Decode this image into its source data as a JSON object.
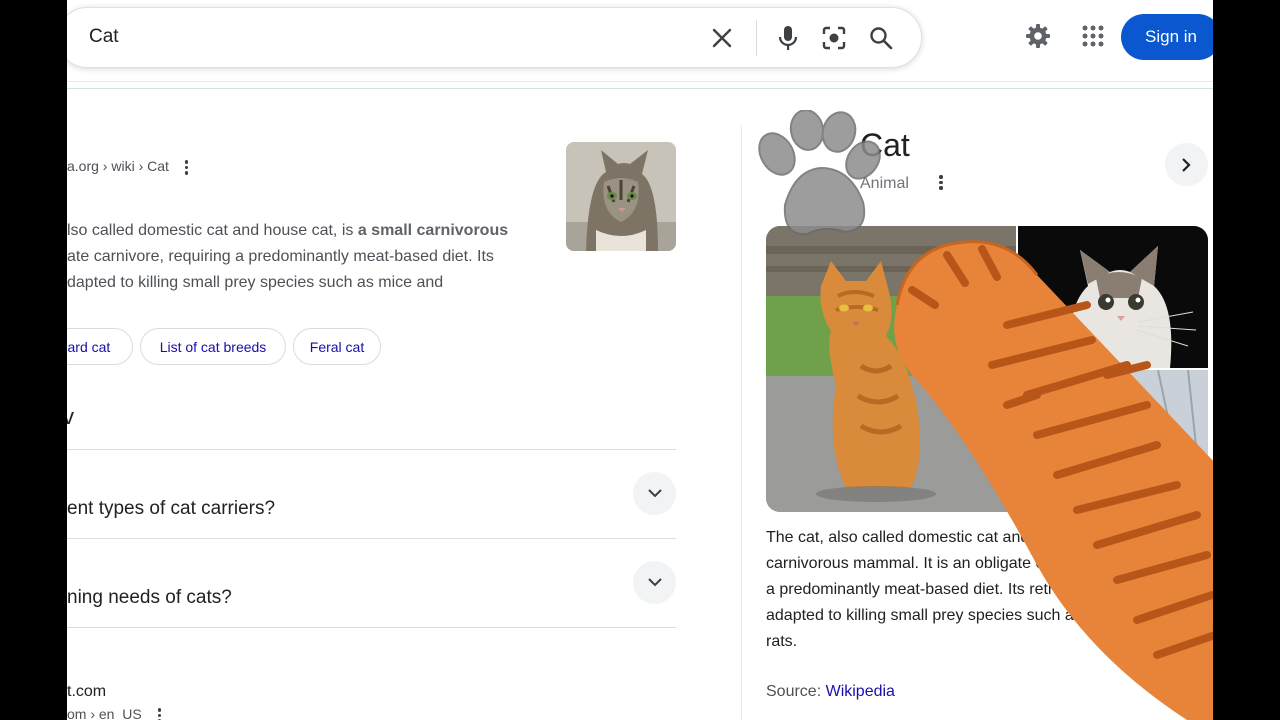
{
  "search": {
    "query": "Cat"
  },
  "header": {
    "sign_in_label": "Sign in"
  },
  "results": {
    "first": {
      "breadcrumb_visible": "a.org › wiki › Cat",
      "snippet_line_1_plain": "lso called domestic cat and house cat, is ",
      "snippet_line_1_bold": "a small carnivorous",
      "snippet_line_2": "ate carnivore, requiring a predominantly meat-based diet. Its",
      "snippet_line_3": "dapted to killing small prey species such as mice and"
    },
    "chips": [
      {
        "label": "bard cat"
      },
      {
        "label": "List of cat breeds"
      },
      {
        "label": "Feral cat"
      }
    ],
    "paa_title": "v",
    "questions": [
      {
        "label": "ent types of cat carriers?"
      },
      {
        "label": "ning needs of cats?"
      }
    ],
    "second": {
      "site": "t.com",
      "breadcrumb": "om › en_US"
    }
  },
  "knowledge_panel": {
    "title": "Cat",
    "subtitle": "Animal",
    "description_lines": [
      "The cat, also called domestic cat and h",
      "carnivorous mammal. It is an obligate carni",
      "a predominantly meat-based diet. Its retracta",
      "adapted to killing small prey species such as mic",
      "rats."
    ],
    "source_label": "Source: ",
    "source_link": "Wikipedia"
  },
  "icons": {
    "clear": "close-icon",
    "voice": "mic-icon",
    "lens": "camera-lens-icon",
    "search": "search-icon",
    "settings": "gear-icon",
    "apps": "apps-grid-icon",
    "expand": "chevron-down-icon",
    "next": "chevron-right-icon"
  },
  "colors": {
    "sign_in_bg": "#0b57d0",
    "link": "#1a0dab",
    "paw_orange": "#e8833a"
  }
}
